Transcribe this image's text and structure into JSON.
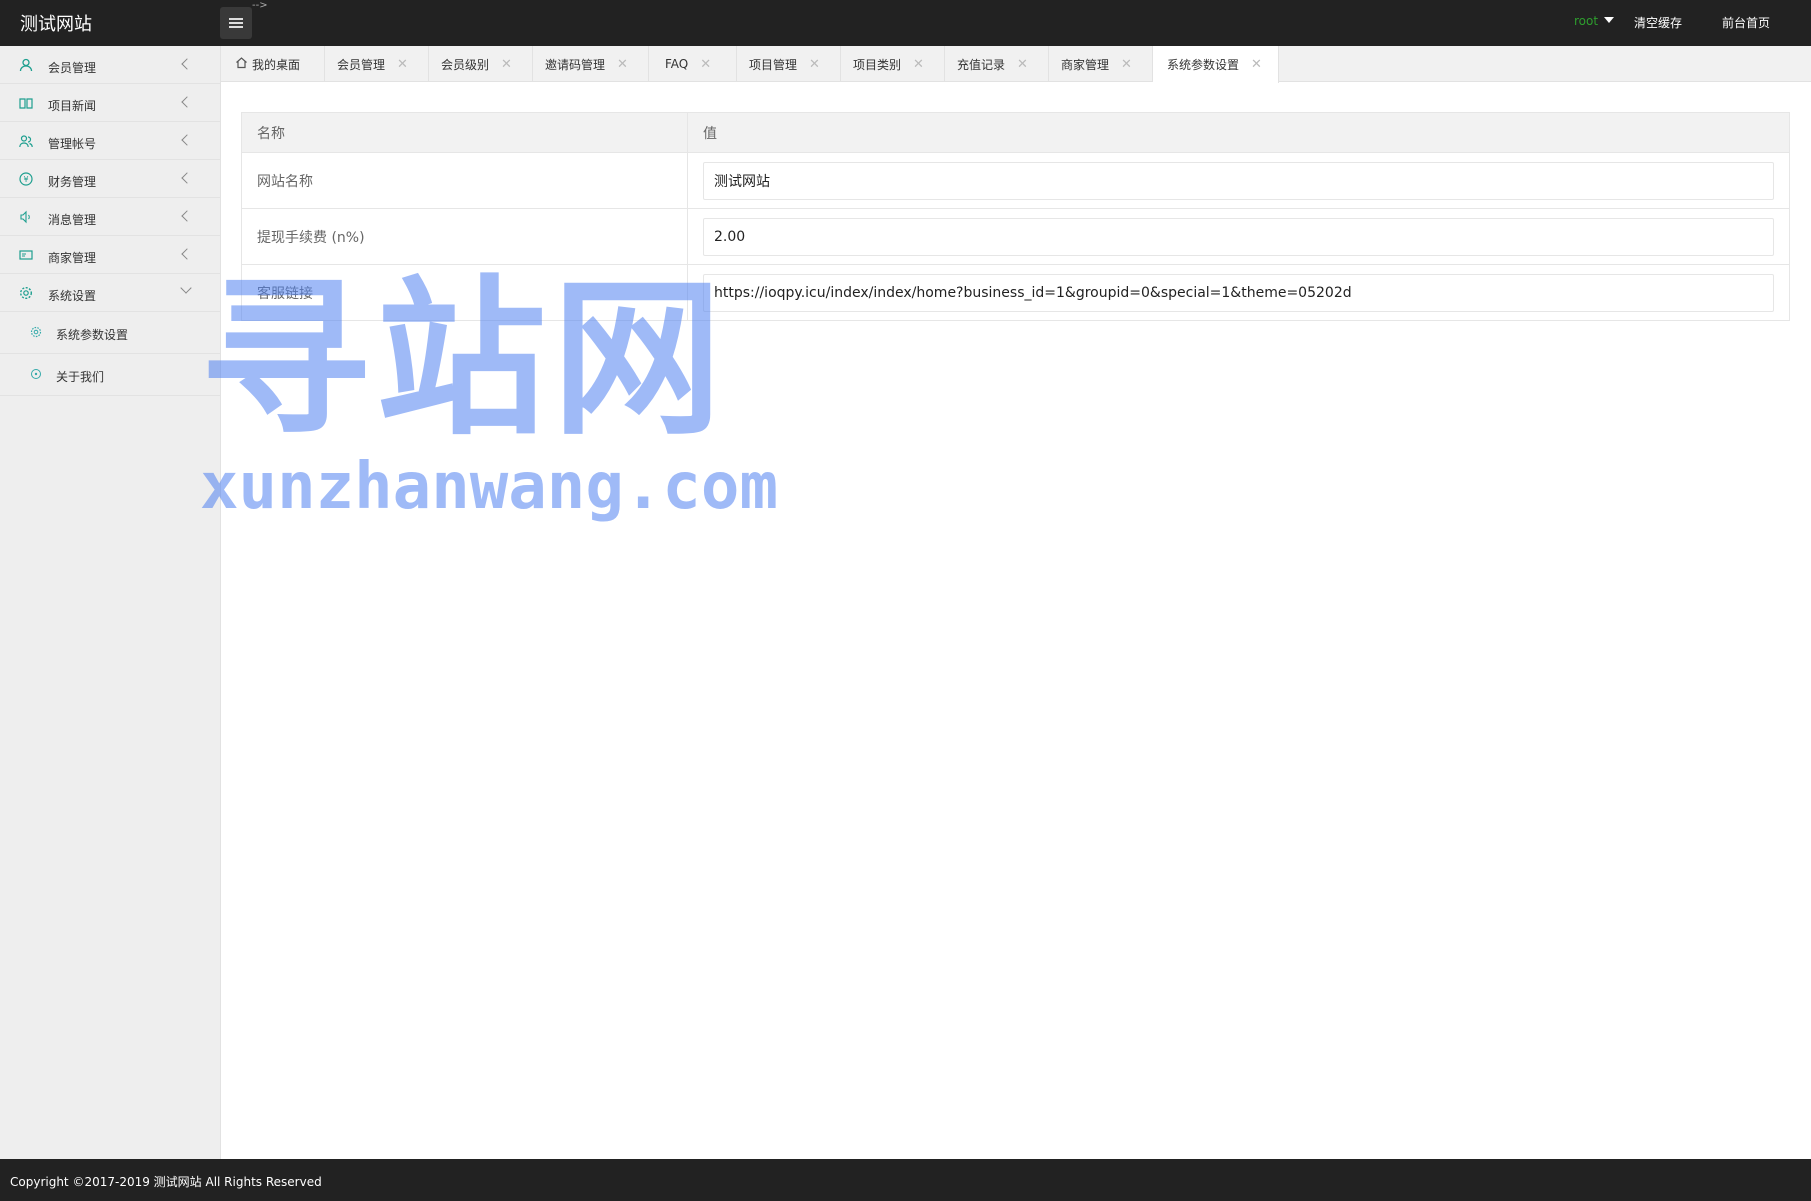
{
  "app": {
    "title": "测试网站",
    "stray_mark": "-->"
  },
  "header": {
    "user": "root",
    "clear_cache": "清空缓存",
    "front_home": "前台首页"
  },
  "sidebar": {
    "items": [
      {
        "label": "会员管理",
        "icon": "user-icon"
      },
      {
        "label": "项目新闻",
        "icon": "book-icon"
      },
      {
        "label": "管理帐号",
        "icon": "users-icon"
      },
      {
        "label": "财务管理",
        "icon": "money-icon"
      },
      {
        "label": "消息管理",
        "icon": "speaker-icon"
      },
      {
        "label": "商家管理",
        "icon": "card-icon"
      },
      {
        "label": "系统设置",
        "icon": "gear-icon",
        "expanded": true
      }
    ],
    "sub_items": [
      {
        "label": "系统参数设置",
        "icon": "gear-icon"
      },
      {
        "label": "关于我们",
        "icon": "circle-icon"
      }
    ]
  },
  "tabs": [
    {
      "label": "我的桌面",
      "closable": false
    },
    {
      "label": "会员管理",
      "closable": true
    },
    {
      "label": "会员级别",
      "closable": true
    },
    {
      "label": "邀请码管理",
      "closable": true
    },
    {
      "label": "FAQ",
      "closable": true
    },
    {
      "label": "项目管理",
      "closable": true
    },
    {
      "label": "项目类别",
      "closable": true
    },
    {
      "label": "充值记录",
      "closable": true
    },
    {
      "label": "商家管理",
      "closable": true
    },
    {
      "label": "系统参数设置",
      "closable": true,
      "active": true
    }
  ],
  "table": {
    "headers": [
      "名称",
      "值"
    ],
    "rows": [
      {
        "name": "网站名称",
        "value": "测试网站"
      },
      {
        "name": "提现手续费 (n%)",
        "value": "2.00"
      },
      {
        "name": "客服链接",
        "value": "https://ioqpy.icu/index/index/home?business_id=1&groupid=0&special=1&theme=05202d"
      }
    ]
  },
  "watermark": {
    "big": "寻站网",
    "small": "xunzhanwang.com"
  },
  "footer": {
    "copyright": "Copyright ©2017-2019 测试网站 All Rights Reserved"
  },
  "colors": {
    "header_bg": "#222222",
    "accent": "#1e9f8f",
    "user_green": "#2e9e2e",
    "watermark": "#5082f0"
  }
}
